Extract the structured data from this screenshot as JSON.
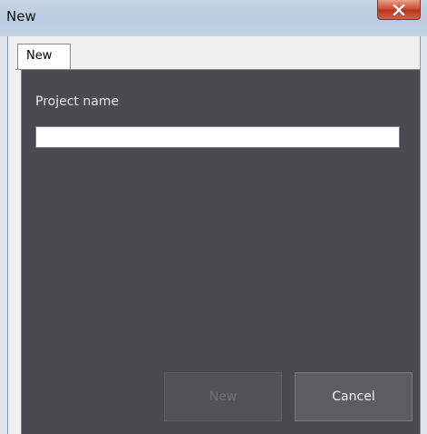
{
  "window": {
    "title": "New"
  },
  "tabs": [
    {
      "label": "New",
      "active": true
    }
  ],
  "form": {
    "project_name_label": "Project name",
    "project_name_value": "",
    "project_name_placeholder": ""
  },
  "buttons": {
    "new_label": "New",
    "new_enabled": false,
    "cancel_label": "Cancel"
  },
  "icons": {
    "close": "close-icon"
  },
  "colors": {
    "panel_background": "#4b4b4f",
    "close_button": "#c7452b"
  }
}
